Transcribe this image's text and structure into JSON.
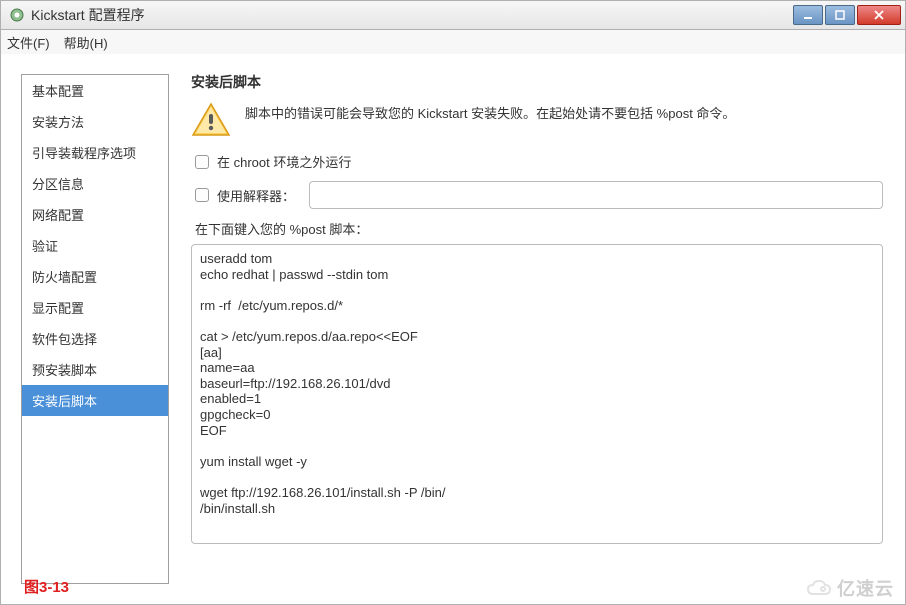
{
  "window": {
    "title": "Kickstart 配置程序"
  },
  "menubar": {
    "file": "文件(F)",
    "help": "帮助(H)"
  },
  "sidebar": {
    "items": [
      {
        "label": "基本配置"
      },
      {
        "label": "安装方法"
      },
      {
        "label": "引导装载程序选项"
      },
      {
        "label": "分区信息"
      },
      {
        "label": "网络配置"
      },
      {
        "label": "验证"
      },
      {
        "label": "防火墙配置"
      },
      {
        "label": "显示配置"
      },
      {
        "label": "软件包选择"
      },
      {
        "label": "预安装脚本"
      },
      {
        "label": "安装后脚本",
        "selected": true
      }
    ]
  },
  "content": {
    "heading": "安装后脚本",
    "warning": "脚本中的错误可能会导致您的  Kickstart 安装失败。在起始处请不要包括 %post 命令。",
    "chroot_label": "在  chroot 环境之外运行",
    "chroot_checked": false,
    "interpreter_label": "使用解释器：",
    "interpreter_checked": false,
    "interpreter_value": "",
    "script_label": "在下面键入您的 %post 脚本：",
    "script_value": "useradd tom\necho redhat | passwd --stdin tom\n\nrm -rf  /etc/yum.repos.d/*\n\ncat > /etc/yum.repos.d/aa.repo<<EOF\n[aa]\nname=aa\nbaseurl=ftp://192.168.26.101/dvd\nenabled=1\ngpgcheck=0\nEOF\n\nyum install wget -y\n\nwget ftp://192.168.26.101/install.sh -P /bin/\n/bin/install.sh"
  },
  "footer": {
    "figure_label": "图3-13",
    "watermark_text": "亿速云"
  }
}
